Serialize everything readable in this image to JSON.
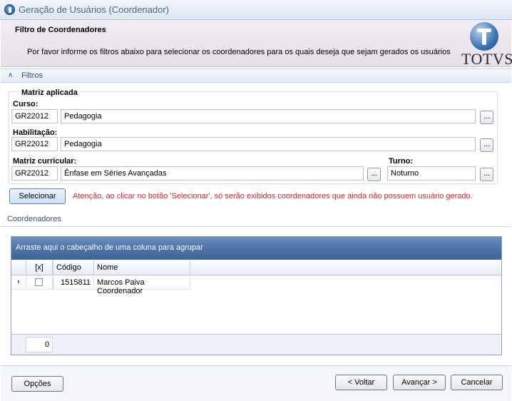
{
  "window": {
    "title": "Geração de Usuários (Coordenador)"
  },
  "header": {
    "title": "Filtro de Coordenadores",
    "description": "Por favor informe os filtros abaixo para selecionar os coordenadores para os quais deseja que sejam gerados os usuários",
    "logo_text": "TOTVS"
  },
  "filters": {
    "section_label": "Filtros",
    "group_label": "Matriz aplicada",
    "curso": {
      "label": "Curso:",
      "code": "GR22012",
      "name": "Pedagogia"
    },
    "habilitacao": {
      "label": "Habilitação:",
      "code": "GR22012",
      "name": "Pedagogia"
    },
    "matriz": {
      "label": "Matriz curricular:",
      "code": "GR22012",
      "name": "Ênfase em Séries Avançadas"
    },
    "turno": {
      "label": "Turno:",
      "value": "Noturno"
    },
    "lookup_label": "...",
    "select_button": "Selecionar",
    "warning": "Atenção, ao clicar no botão 'Selecionar', só serão exibidos coordenadores que ainda não possuem usuário gerado."
  },
  "coordenadores": {
    "section_label": "Coordenadores",
    "group_hint": "Arraste aqui o cabeçalho de uma coluna para agrupar",
    "columns": {
      "check": "[x]",
      "codigo": "Código",
      "nome": "Nome"
    },
    "rows": [
      {
        "indicator": "›",
        "checked": false,
        "codigo": "1515811",
        "nome": "Marcos Paiva Coordenador"
      }
    ],
    "count": "0"
  },
  "buttons": {
    "options": "Opções",
    "back": "< Voltar",
    "next": "Avançar >",
    "cancel": "Cancelar"
  },
  "colors": {
    "warning": "#d8232a",
    "grid_header": "#4e74aa",
    "section_text": "#2f4d7a"
  }
}
